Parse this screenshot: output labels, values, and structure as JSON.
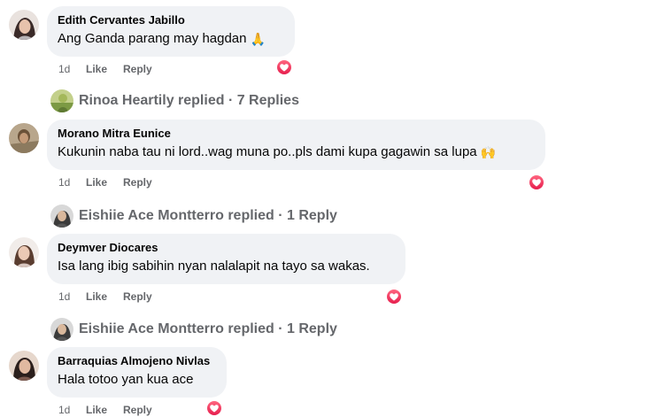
{
  "comments": [
    {
      "author": "Edith Cervantes Jabillo",
      "text": "Ang Ganda parang may hagdan",
      "emoji": "🙏",
      "time": "1d",
      "like": "Like",
      "reply": "Reply",
      "reaction": "love"
    },
    {
      "author": "Morano Mitra Eunice",
      "text": "Kukunin naba tau ni lord..wag muna po..pls dami kupa gagawin sa lupa",
      "emoji": "🙌",
      "time": "1d",
      "like": "Like",
      "reply": "Reply",
      "reaction": "love"
    },
    {
      "author": "Deymver Diocares",
      "text": "Isa lang ibig sabihin nyan nalalapit na tayo sa wakas.",
      "emoji": "",
      "time": "1d",
      "like": "Like",
      "reply": "Reply",
      "reaction": "love"
    },
    {
      "author": "Barraquias Almojeno Nivlas",
      "text": "Hala totoo yan kua ace",
      "emoji": "",
      "time": "1d",
      "like": "Like",
      "reply": "Reply",
      "reaction": "love"
    }
  ],
  "reply_summaries": [
    {
      "text": "Rinoa Heartily replied · 7 Replies"
    },
    {
      "text": "Eishiie Ace Montterro replied · 1 Reply"
    },
    {
      "text": "Eishiie Ace Montterro replied · 1 Reply"
    }
  ],
  "colors": {
    "bubble": "#f0f2f5",
    "meta": "#65676b",
    "text": "#050505",
    "love": "#e61e4d"
  },
  "icons": {
    "reaction": "love-heart-icon"
  }
}
